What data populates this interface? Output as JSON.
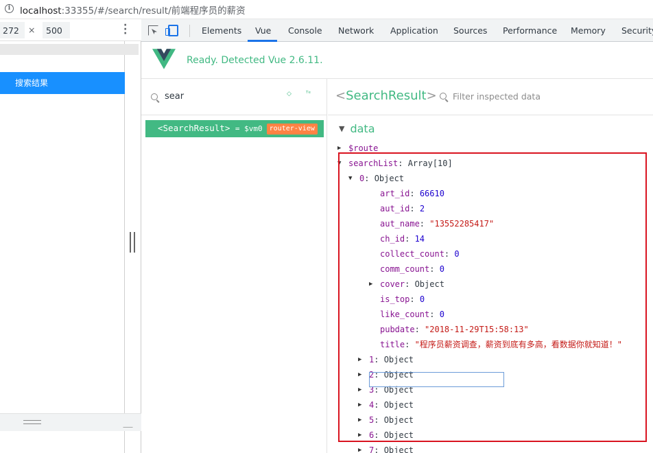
{
  "browser": {
    "url_host": "localhost",
    "url_path": ":33355/#/search/result/前端程序员的薪资",
    "info_icon": "info-icon"
  },
  "device_toolbar": {
    "width": "272",
    "times": "×",
    "height": "500",
    "more_icon": "more-vert-icon"
  },
  "viewport": {
    "active_item": "搜索结果"
  },
  "devtools": {
    "tabs": [
      "Elements",
      "Vue",
      "Console",
      "Network",
      "Application",
      "Sources",
      "Performance",
      "Memory",
      "Security"
    ],
    "active_tab": "Vue"
  },
  "vue": {
    "detected_text": "Ready. Detected Vue 2.6.11.",
    "component_search_value": "sear",
    "component_row": {
      "name": "<SearchResult>",
      "vm": "= $vm0",
      "badge": "router-view"
    },
    "selected_component": {
      "open": "<",
      "name": "SearchResult",
      "close": ">"
    },
    "filter_placeholder": "Filter inspected data",
    "section_title": "data"
  },
  "tree": {
    "route_key": "$route",
    "searchList_key": "searchList",
    "searchList_type": "Array[10]",
    "item0_key": "0",
    "item0_type": "Object",
    "fields": [
      {
        "key": "art_id",
        "value": "66610",
        "kind": "num"
      },
      {
        "key": "aut_id",
        "value": "2",
        "kind": "num"
      },
      {
        "key": "aut_name",
        "value": "\"13552285417\"",
        "kind": "str"
      },
      {
        "key": "ch_id",
        "value": "14",
        "kind": "num"
      },
      {
        "key": "collect_count",
        "value": "0",
        "kind": "num"
      },
      {
        "key": "comm_count",
        "value": "0",
        "kind": "num"
      },
      {
        "key": "cover",
        "value": "Object",
        "kind": "obj"
      },
      {
        "key": "is_top",
        "value": "0",
        "kind": "num"
      },
      {
        "key": "like_count",
        "value": "0",
        "kind": "num"
      },
      {
        "key": "pubdate",
        "value": "\"2018-11-29T15:58:13\"",
        "kind": "str"
      },
      {
        "key": "title",
        "value": "\"程序员薪资调查，薪资到底有多高，看数据你就知道！\"",
        "kind": "str"
      }
    ],
    "items": [
      {
        "key": "1",
        "type": "Object"
      },
      {
        "key": "2",
        "type": "Object"
      },
      {
        "key": "3",
        "type": "Object"
      },
      {
        "key": "4",
        "type": "Object"
      },
      {
        "key": "5",
        "type": "Object"
      },
      {
        "key": "6",
        "type": "Object"
      },
      {
        "key": "7",
        "type": "Object"
      }
    ]
  },
  "colors": {
    "vue_green": "#42b983",
    "highlight_red": "#d9131f",
    "active_blue": "#1890ff"
  }
}
